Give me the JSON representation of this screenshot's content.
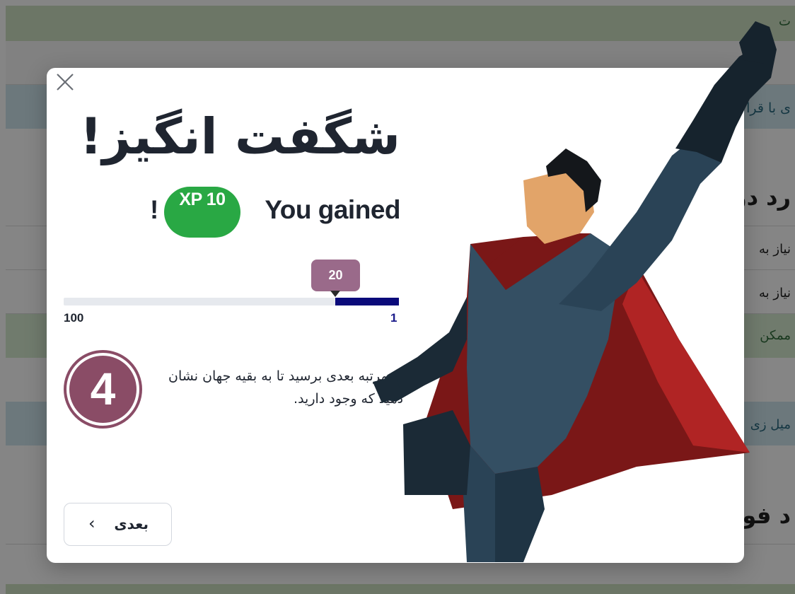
{
  "background": {
    "lines": [
      "ت",
      "ی با قرا",
      "رد در",
      "نیاز به",
      "نیاز به",
      "ممکن",
      "میل زی",
      "د فو"
    ]
  },
  "modal": {
    "title": "شگفت انگیز!",
    "gained_text": "You gained",
    "xp_label": "XP 10",
    "exclaim": "!",
    "progress": {
      "tooltip_value": "20",
      "max_label": "100",
      "min_label": "1",
      "fill_fraction": 0.19
    },
    "rank_number": "4",
    "rank_message": "به مرتبه بعدی برسید تا به بقیه جهان نشان دهید که وجود دارید.",
    "next_button_label": "بعدی",
    "next_button_icon": "chevron-left-icon",
    "close_icon": "close-icon"
  },
  "colors": {
    "xp_green": "#29a844",
    "rank_purple": "#8a4c66",
    "progress_navy": "#0a0a7a",
    "tooltip": "#9a6a8a"
  }
}
